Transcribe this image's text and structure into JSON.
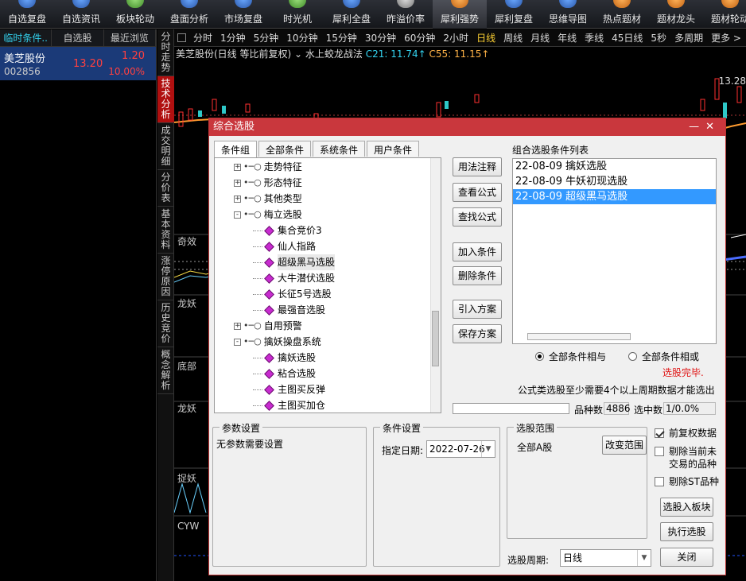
{
  "toolbar": [
    {
      "label": "自选复盘",
      "icon": "blue"
    },
    {
      "label": "自选资讯",
      "icon": "blue"
    },
    {
      "label": "板块轮动",
      "icon": "green"
    },
    {
      "label": "盘面分析",
      "icon": "blue"
    },
    {
      "label": "市场复盘",
      "icon": "blue"
    },
    {
      "label": "时光机",
      "icon": "green"
    },
    {
      "label": "犀利全盘",
      "icon": "blue"
    },
    {
      "label": "昨溢价率",
      "icon": "gray"
    },
    {
      "label": "犀利强势",
      "icon": "orange",
      "active": true
    },
    {
      "label": "犀利复盘",
      "icon": "blue"
    },
    {
      "label": "思维导图",
      "icon": "blue"
    },
    {
      "label": "热点题材",
      "icon": "orange"
    },
    {
      "label": "题材龙头",
      "icon": "orange"
    },
    {
      "label": "题材轮动",
      "icon": "orange"
    }
  ],
  "left_tabs": [
    "临时条件..",
    "自选股",
    "最近浏览"
  ],
  "stock": {
    "name": "美芝股份",
    "code": "002856",
    "price": "13.20",
    "change": "1.20",
    "pct": "10.00%"
  },
  "vertical_tabs": [
    "分时走势",
    "技术分析",
    "成交明细",
    "分价表",
    "基本资料",
    "涨停原因",
    "历史竞价",
    "概念解析"
  ],
  "period_bar": [
    "分时",
    "1分钟",
    "5分钟",
    "10分钟",
    "15分钟",
    "30分钟",
    "60分钟",
    "2小时",
    "日线",
    "周线",
    "月线",
    "年线",
    "季线",
    "45日线",
    "5秒",
    "多周期",
    "更多 >"
  ],
  "chart": {
    "title": "美芝股份(日线 等比前复权)",
    "indicator": "水上蛟龙战法",
    "c21": "C21: 11.74↑",
    "c55": "C55: 11.15↑",
    "price_label": "13.28",
    "sub_labels": [
      "奇效",
      "龙妖",
      "底部",
      "龙妖",
      "捉妖",
      "CYW"
    ]
  },
  "dialog": {
    "title": "综合选股",
    "tabs": [
      "条件组",
      "全部条件",
      "系统条件",
      "用户条件"
    ],
    "tree": [
      {
        "indent": 0,
        "type": "group",
        "exp": "+",
        "label": "走势特征"
      },
      {
        "indent": 0,
        "type": "group",
        "exp": "+",
        "label": "形态特征"
      },
      {
        "indent": 0,
        "type": "group",
        "exp": "+",
        "label": "其他类型"
      },
      {
        "indent": 0,
        "type": "group",
        "exp": "-",
        "label": "梅立选股"
      },
      {
        "indent": 1,
        "type": "leaf",
        "label": "集合竞价3"
      },
      {
        "indent": 1,
        "type": "leaf",
        "label": "仙人指路"
      },
      {
        "indent": 1,
        "type": "leaf",
        "label": "超级黑马选股",
        "selected": true
      },
      {
        "indent": 1,
        "type": "leaf",
        "label": "大牛潜伏选股"
      },
      {
        "indent": 1,
        "type": "leaf",
        "label": "长征5号选股"
      },
      {
        "indent": 1,
        "type": "leaf",
        "label": "最强音选股"
      },
      {
        "indent": 0,
        "type": "group",
        "exp": "+",
        "label": "自用预警"
      },
      {
        "indent": 0,
        "type": "group",
        "exp": "-",
        "label": "擒妖操盘系统"
      },
      {
        "indent": 1,
        "type": "leaf",
        "label": "擒妖选股"
      },
      {
        "indent": 1,
        "type": "leaf",
        "label": "粘合选股"
      },
      {
        "indent": 1,
        "type": "leaf",
        "label": "主图买反弹"
      },
      {
        "indent": 1,
        "type": "leaf",
        "label": "主图买加仓"
      }
    ],
    "buttons_mid": [
      "用法注释",
      "查看公式",
      "查找公式",
      "加入条件",
      "删除条件",
      "引入方案",
      "保存方案"
    ],
    "list_label": "组合选股条件列表",
    "conditions": [
      {
        "text": "22-08-09 擒妖选股"
      },
      {
        "text": "22-08-09 牛妖初现选股"
      },
      {
        "text": "22-08-09 超级黑马选股",
        "selected": true
      }
    ],
    "radio_and": "全部条件相与",
    "radio_or": "全部条件相或",
    "status": "选股完毕.",
    "note": "公式类选股至少需要4个以上周期数据才能选出",
    "count_label": "品种数",
    "count_value": "4886",
    "selected_label": "选中数",
    "selected_value": "1/0.0%",
    "params_title": "参数设置",
    "params_text": "无参数需要设置",
    "cond_title": "条件设置",
    "date_label": "指定日期:",
    "date_value": "2022-07-26",
    "range_title": "选股范围",
    "range_value": "全部A股",
    "change_range": "改变范围",
    "chk_fuquan": "前复权数据",
    "chk_remove1": "剔除当前未",
    "chk_remove1b": "交易的品种",
    "chk_st": "剔除ST品种",
    "btn_to_block": "选股入板块",
    "btn_execute": "执行选股",
    "btn_close": "关闭",
    "period_label": "选股周期:",
    "period_value": "日线"
  }
}
